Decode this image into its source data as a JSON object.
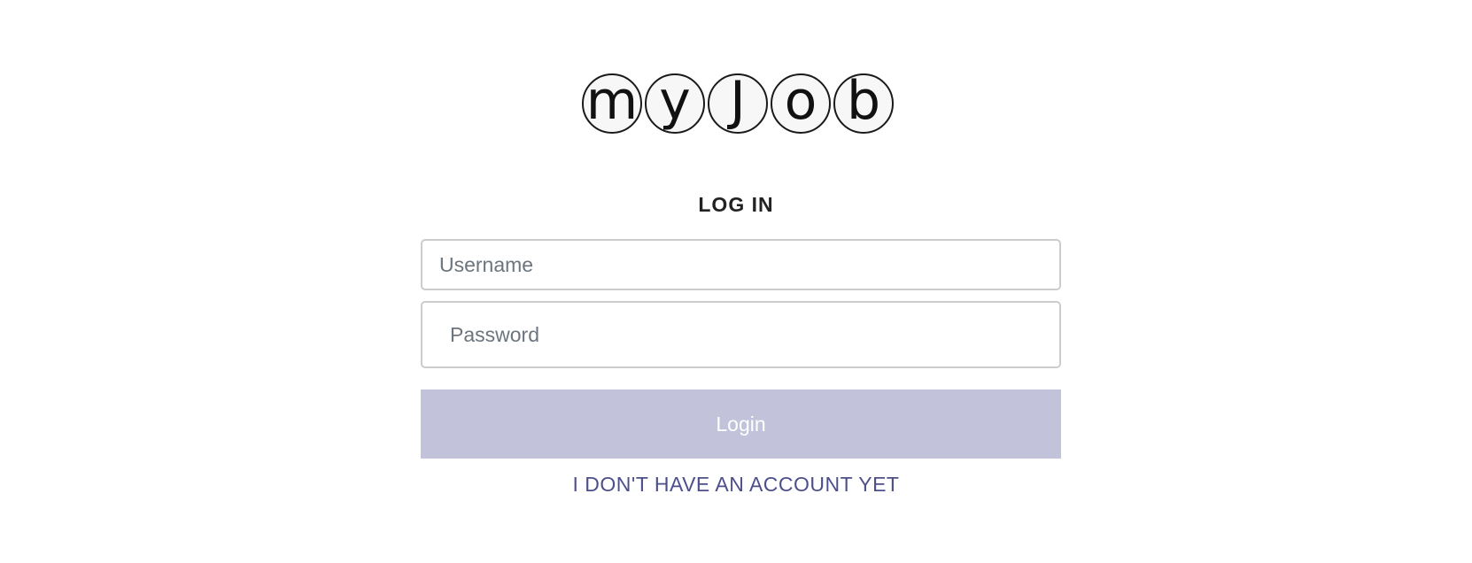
{
  "logo": {
    "letters": [
      "m",
      "y",
      "J",
      "o",
      "b"
    ]
  },
  "form": {
    "title": "LOG IN",
    "username_placeholder": "Username",
    "username_value": "",
    "password_placeholder": "Password",
    "password_value": "",
    "login_label": "Login",
    "signup_link": "I DON'T HAVE AN ACCOUNT YET"
  },
  "colors": {
    "button_disabled_bg": "#c2c3da",
    "link": "#4d4f8a",
    "placeholder": "#6c757d"
  }
}
